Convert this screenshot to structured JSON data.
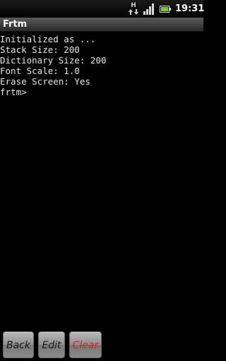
{
  "status_bar": {
    "network_letter": "H",
    "time": "19:31",
    "icons": [
      "hspa-data-icon",
      "signal-strength-icon",
      "battery-icon"
    ]
  },
  "app": {
    "title": "Frtm"
  },
  "console": {
    "lines": [
      "Initialized as ...",
      "Stack Size: 200",
      "Dictionary Size: 200",
      "Font Scale: 1.0",
      "Erase Screen: Yes",
      "frtm>"
    ],
    "text_color": "#e6e6e6",
    "background": "#000000"
  },
  "buttons": {
    "back_label": "Back",
    "edit_label": "Edit",
    "clear_label": "Clear",
    "clear_color": "#e0201b"
  }
}
